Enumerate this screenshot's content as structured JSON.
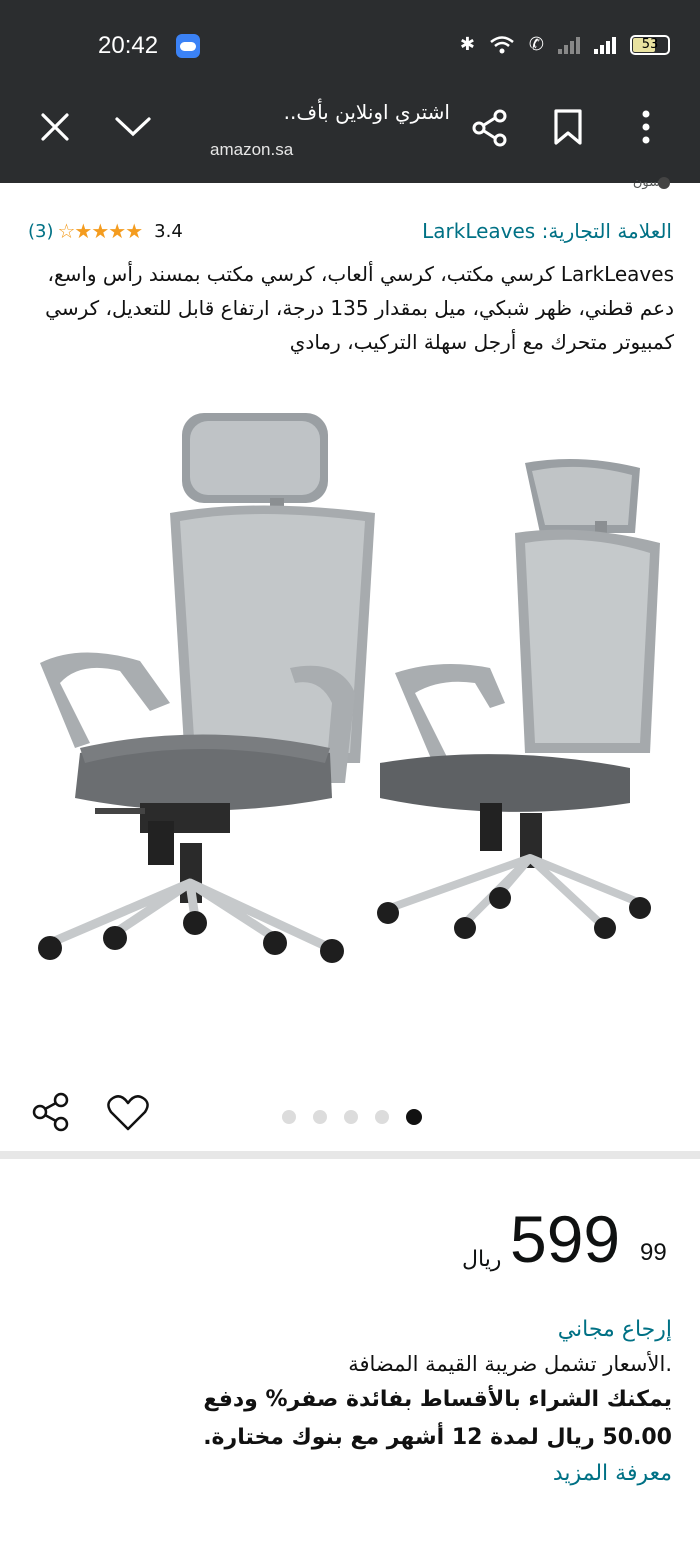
{
  "status_bar": {
    "time": "20:42",
    "battery": "53"
  },
  "browser": {
    "tab_title": "اشتري اونلاين بأف..",
    "url": "amazon.sa",
    "close_icon": "close-icon",
    "collapse_icon": "chevron-down-icon",
    "share_icon": "share-icon",
    "bookmark_icon": "bookmark-icon",
    "menu_icon": "more-vertical-icon"
  },
  "product": {
    "partial_text": "سون",
    "brand": "العلامة التجارية: LarkLeaves",
    "rating_value": "3.4",
    "rating_count": "(3)",
    "title": "LarkLeaves كرسي مكتب، كرسي ألعاب، كرسي مكتب بمسند رأس واسع، دعم قطني، ظهر شبكي، ميل بمقدار 135 درجة، ارتفاع قابل للتعديل، كرسي كمبيوتر متحرك مع أرجل سهلة التركيب، رمادي",
    "image_count": 5,
    "active_image_index": 5
  },
  "price": {
    "whole": "599",
    "fraction": "99",
    "currency": "ريال"
  },
  "details": {
    "free_returns": "إرجاع مجاني",
    "vat_note": ".الأسعار تشمل ضريبة القيمة المضافة",
    "installments_line1": "يمكنك الشراء بالأقساط بفائدة صفر% ودفع",
    "installments_line2": "50.00 ريال لمدة 12 أشهر مع بنوك مختارة.",
    "learn_more": "معرفة المزيد"
  },
  "colors": {
    "link": "#007185",
    "star": "#f49c1f",
    "topbar": "#2b2d2f"
  }
}
